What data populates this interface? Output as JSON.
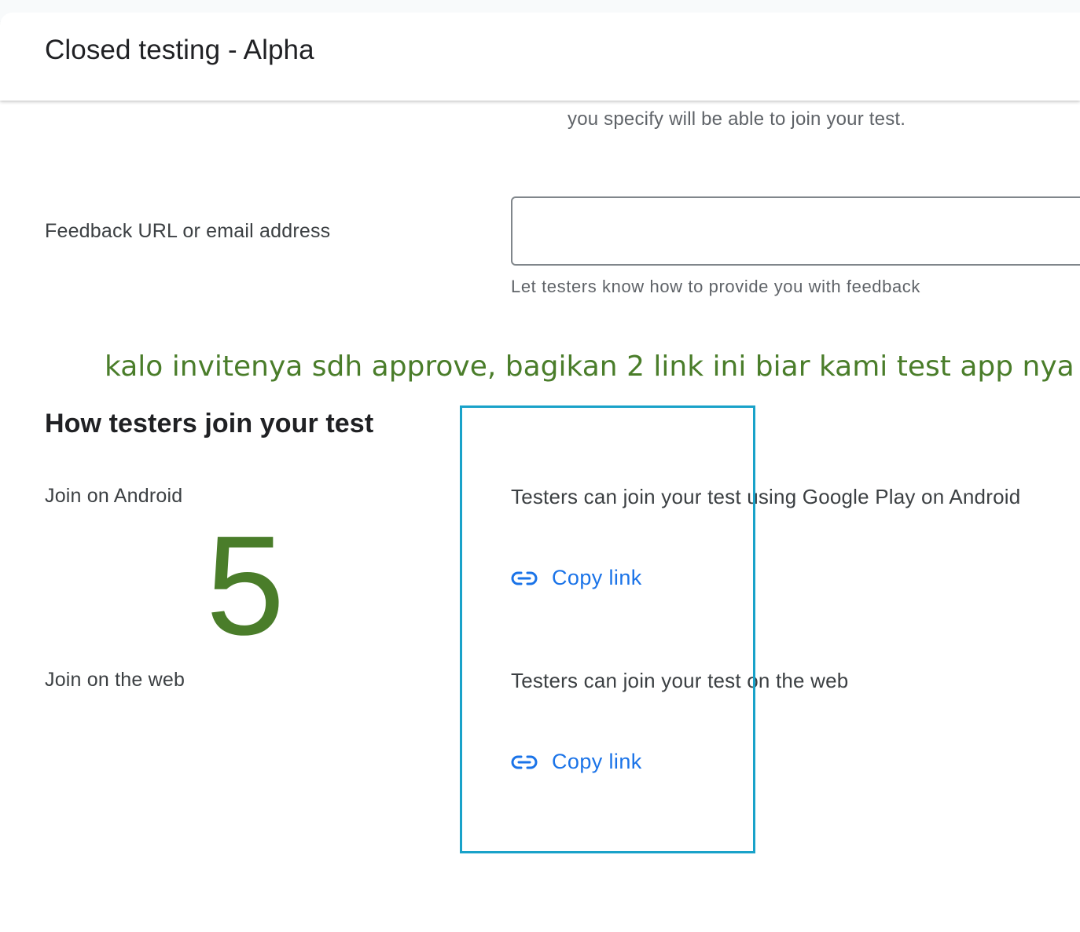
{
  "header": {
    "title": "Closed testing - Alpha"
  },
  "partial_text": {
    "line2": "you specify will be able to join your test."
  },
  "feedback": {
    "label": "Feedback URL or email address",
    "value": "",
    "helper": "Let testers know how to provide you with feedback"
  },
  "annotation": {
    "note": "kalo invitenya sdh approve, bagikan 2 link ini biar kami test app nya",
    "number": "5",
    "color": "#4a7d2a",
    "box_color": "#19a2c9"
  },
  "join_section": {
    "heading": "How testers join your test",
    "android": {
      "label": "Join on Android",
      "description": "Testers can join your test using Google Play on Android",
      "link_label": "Copy link",
      "icon": "link-icon"
    },
    "web": {
      "label": "Join on the web",
      "description": "Testers can join your test on the web",
      "link_label": "Copy link",
      "icon": "link-icon"
    }
  },
  "colors": {
    "link": "#1a73e8",
    "text_primary": "#202124",
    "text_secondary": "#5f6368"
  }
}
